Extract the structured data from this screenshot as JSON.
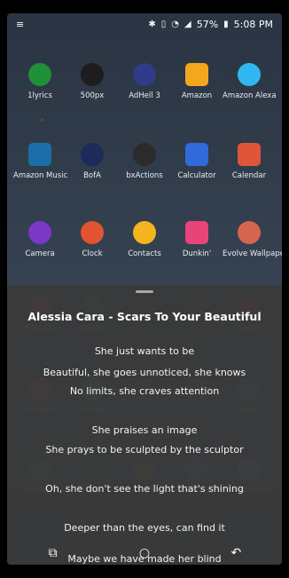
{
  "status": {
    "time": "5:08 PM",
    "battery": "57%",
    "left_icon": "notification-icon"
  },
  "apps": [
    {
      "label": "1lyrics",
      "icon": "music-note-icon",
      "color": "#1f8f3a"
    },
    {
      "label": "500px",
      "icon": "500px-icon",
      "color": "#1d1d1d"
    },
    {
      "label": "AdHell 3",
      "icon": "shield-icon",
      "color": "#2f3c8a"
    },
    {
      "label": "Amazon",
      "icon": "amazon-icon",
      "color": "#f4a61d"
    },
    {
      "label": "Amazon Alexa",
      "icon": "alexa-icon",
      "color": "#2fb8f0"
    },
    {
      "label": "Amazon Music",
      "icon": "music-icon",
      "color": "#1c6ea8"
    },
    {
      "label": "BofA",
      "icon": "bofa-icon",
      "color": "#1d2a5a"
    },
    {
      "label": "bxActions",
      "icon": "bxactions-icon",
      "color": "#2b2b2b"
    },
    {
      "label": "Calculator",
      "icon": "calculator-icon",
      "color": "#2f6bdc"
    },
    {
      "label": "Calendar",
      "icon": "calendar-icon",
      "color": "#e0553a"
    },
    {
      "label": "Camera",
      "icon": "camera-icon",
      "color": "#7a38c8"
    },
    {
      "label": "Clock",
      "icon": "clock-icon",
      "color": "#e2542f"
    },
    {
      "label": "Contacts",
      "icon": "person-icon",
      "color": "#f3b51f"
    },
    {
      "label": "Dunkin'",
      "icon": "dunkin-icon",
      "color": "#e8447a"
    },
    {
      "label": "Evolve Wallpape...",
      "icon": "evolve-icon",
      "color": "#d5664d"
    },
    {
      "label": "Files Go",
      "icon": "files-icon",
      "color": "#c44"
    },
    {
      "label": "Gallery",
      "icon": "gallery-icon",
      "color": "#1b9f62"
    },
    {
      "label": "",
      "icon": "",
      "color": "#555"
    },
    {
      "label": "",
      "icon": "",
      "color": "#555"
    },
    {
      "label": "Gmail",
      "icon": "gmail-icon",
      "color": "#c2362f"
    },
    {
      "label": "Google",
      "icon": "google-icon",
      "color": "#d04c2d"
    },
    {
      "label": "Google",
      "icon": "google-icon",
      "color": "#5a6"
    },
    {
      "label": "",
      "icon": "",
      "color": "#555"
    },
    {
      "label": "",
      "icon": "",
      "color": "#555"
    },
    {
      "label": "Keep",
      "icon": "keep-icon",
      "color": "#2f66b0"
    },
    {
      "label": "Keep",
      "icon": "keep-icon",
      "color": "#3a8f5a"
    },
    {
      "label": "Life",
      "icon": "life-icon",
      "color": "#3b7d3a"
    },
    {
      "label": "Maps",
      "icon": "maps-icon",
      "color": "#ad6a2a"
    },
    {
      "label": "Messages",
      "icon": "messages-icon",
      "color": "#5a6baa"
    },
    {
      "label": "Mobilism",
      "icon": "mobilism-icon",
      "color": "#6a86c8"
    }
  ],
  "lyrics": {
    "title": "Alessia Cara - Scars To Your Beautiful",
    "lines": [
      "She just wants to be",
      "Beautiful, she goes unnoticed, she knows",
      "No limits, she craves attention",
      "She praises an image",
      "She prays to be sculpted by the sculptor",
      "Oh, she don't see the light that's shining",
      "Deeper than the eyes, can find it",
      "Maybe we have made her blind"
    ]
  },
  "nav": {
    "recents": "recents-icon",
    "home": "home-icon",
    "back": "back-icon"
  }
}
